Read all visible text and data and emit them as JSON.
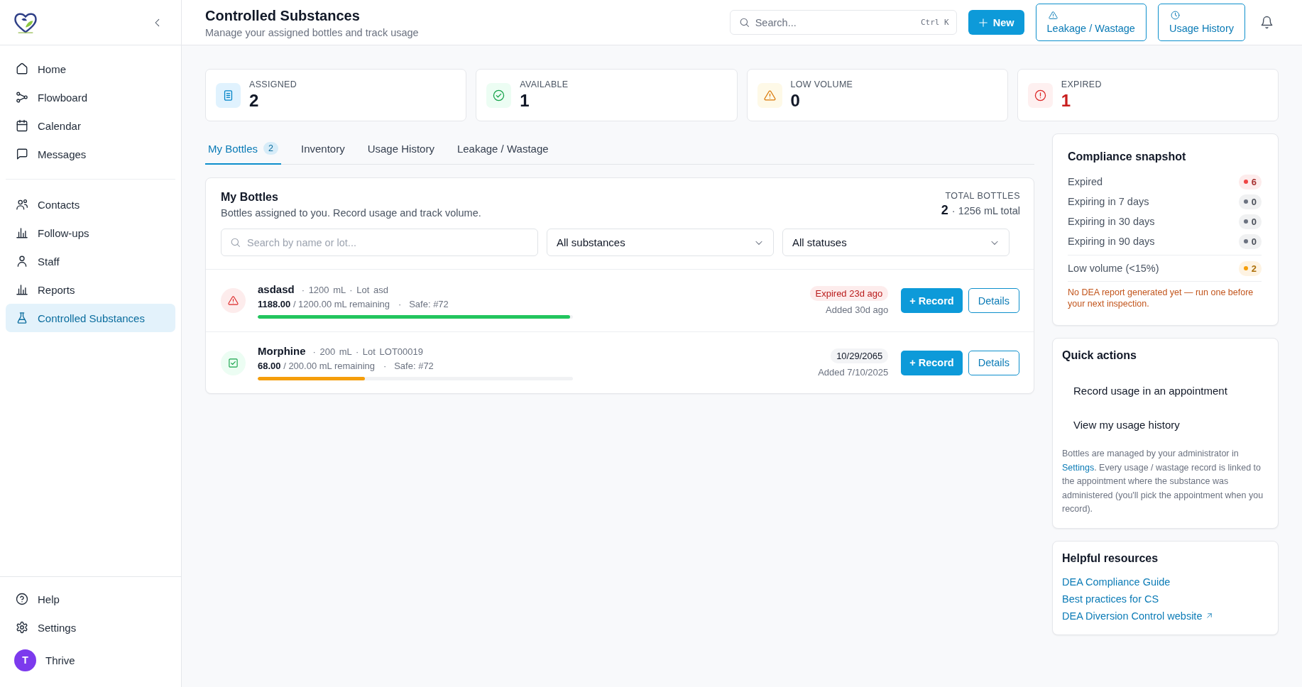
{
  "sidebar": {
    "nav_groups": [
      {
        "items": [
          {
            "label": "Home",
            "selected": false
          },
          {
            "label": "Flowboard",
            "selected": false
          },
          {
            "label": "Calendar",
            "selected": false
          },
          {
            "label": "Messages",
            "selected": false
          }
        ]
      },
      {
        "items": [
          {
            "label": "Contacts",
            "selected": false
          },
          {
            "label": "Follow-ups",
            "selected": false
          },
          {
            "label": "Staff",
            "selected": false
          },
          {
            "label": "Reports",
            "selected": false
          },
          {
            "label": "Controlled Substances",
            "selected": true
          }
        ]
      }
    ],
    "footer_items": [
      {
        "label": "Help",
        "selected": false
      },
      {
        "label": "Settings",
        "selected": false
      }
    ],
    "user": {
      "initial": "T",
      "name": "Thrive"
    }
  },
  "header": {
    "title": "Controlled Substances",
    "subtitle": "Manage your assigned bottles and track usage",
    "search": {
      "placeholder": "Search...",
      "shortcut": "Ctrl K"
    },
    "buttons": [
      {
        "kind": "new",
        "label": "New"
      },
      {
        "kind": "leakage",
        "label": "Leakage / Wastage"
      },
      {
        "kind": "history",
        "label": "Usage History"
      }
    ]
  },
  "stats": [
    {
      "kind": "assigned",
      "label": "ASSIGNED",
      "value": "2"
    },
    {
      "kind": "available",
      "label": "AVAILABLE",
      "value": "1"
    },
    {
      "kind": "low",
      "label": "LOW VOLUME",
      "value": "0"
    },
    {
      "kind": "expired",
      "label": "EXPIRED",
      "value": "1"
    }
  ],
  "tabs": [
    {
      "label": "My Bottles",
      "count": "2",
      "selected": true
    },
    {
      "label": "Inventory",
      "selected": false
    },
    {
      "label": "Usage History",
      "selected": false
    },
    {
      "label": "Leakage / Wastage",
      "selected": false
    }
  ],
  "bottles_panel": {
    "title": "My Bottles",
    "subtitle": "Bottles assigned to you. Record usage and track volume.",
    "total_label": "TOTAL BOTTLES",
    "total_count": "2",
    "total_volume": "· 1256 mL total",
    "search": {
      "placeholder": "Search by name or lot..."
    },
    "filters": [
      {
        "value": "All substances"
      },
      {
        "value": "All statuses"
      }
    ],
    "bottles": [
      {
        "kind": "expired",
        "name": "asdasd",
        "details": "· 1200 mL · Lot asd",
        "remaining": "**1188.00** / 1200.00 mL remaining",
        "location": "·   Safe: #72",
        "level": 0.99,
        "color": "#22c55e",
        "badge": "Expired 23d ago",
        "added": "Added 30d ago",
        "record_label": "+ Record",
        "details_label": "Details"
      },
      {
        "kind": "available",
        "name": "Morphine",
        "details": "· 200 mL · Lot LOT00019",
        "remaining": "**68.00** / 200.00 mL remaining",
        "location": "·   Safe: #72",
        "level": 0.34,
        "color": "#f59e0b",
        "badge": "10/29/2065",
        "added": "Added 7/10/2025",
        "record_label": "+ Record",
        "details_label": "Details"
      }
    ]
  },
  "compliance": {
    "title": "Compliance snapshot",
    "expiry_rows": [
      {
        "label": "Expired",
        "count": "6",
        "color": "#ef4444"
      },
      {
        "label": "Expiring in 7 days",
        "count": "0",
        "color": "#6b7280"
      },
      {
        "label": "Expiring in 30 days",
        "count": "0",
        "color": "#6b7280"
      },
      {
        "label": "Expiring in 90 days",
        "count": "0",
        "color": "#6b7280"
      }
    ],
    "volume_rows": [
      {
        "label": "Low volume (<15%)",
        "count": "2",
        "color": "#f59e0b"
      }
    ],
    "notice": "No DEA report generated yet — run one before your next inspection."
  },
  "quick_actions": {
    "title": "Quick actions",
    "actions": [
      "Record usage in an appointment",
      "View my usage history"
    ],
    "note": {
      "before": "Bottles are managed by your administrator in",
      "link": "Settings",
      "after": ". Every usage / wastage record is linked to the appointment where the substance was administered (you'll pick the appointment when you record)."
    }
  },
  "resources": {
    "title": "Helpful resources",
    "links": [
      {
        "label": "DEA Compliance Guide",
        "external": false
      },
      {
        "label": "Best practices for CS",
        "external": false
      },
      {
        "label": "DEA Diversion Control website",
        "external": true
      }
    ]
  }
}
